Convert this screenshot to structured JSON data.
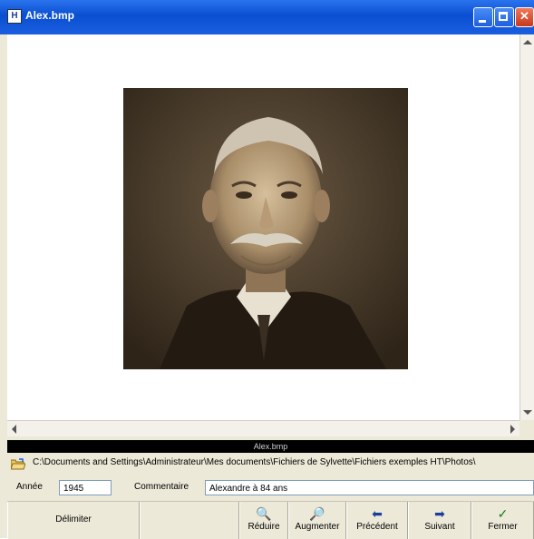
{
  "window": {
    "title": "Alex.bmp",
    "title_icon": "H"
  },
  "image": {
    "description_icon": "portrait-photo"
  },
  "caption": "Alex.bmp",
  "path": "C:\\Documents and Settings\\Administrateur\\Mes documents\\Fichiers de Sylvette\\Fichiers exemples HT\\Photos\\",
  "fields": {
    "annee_label": "Année",
    "annee_value": "1945",
    "commentaire_label": "Commentaire",
    "commentaire_value": "Alexandre à 84 ans"
  },
  "toolbar": {
    "delimiter_label": "Délimiter",
    "reduce_label": "Réduire",
    "augment_label": "Augmenter",
    "previous_label": "Précédent",
    "next_label": "Suivant",
    "close_label": "Fermer"
  },
  "colors": {
    "titlebar": "#0a4fd1",
    "face": "#ece9d8",
    "photo_tone": "#5a4a36"
  }
}
